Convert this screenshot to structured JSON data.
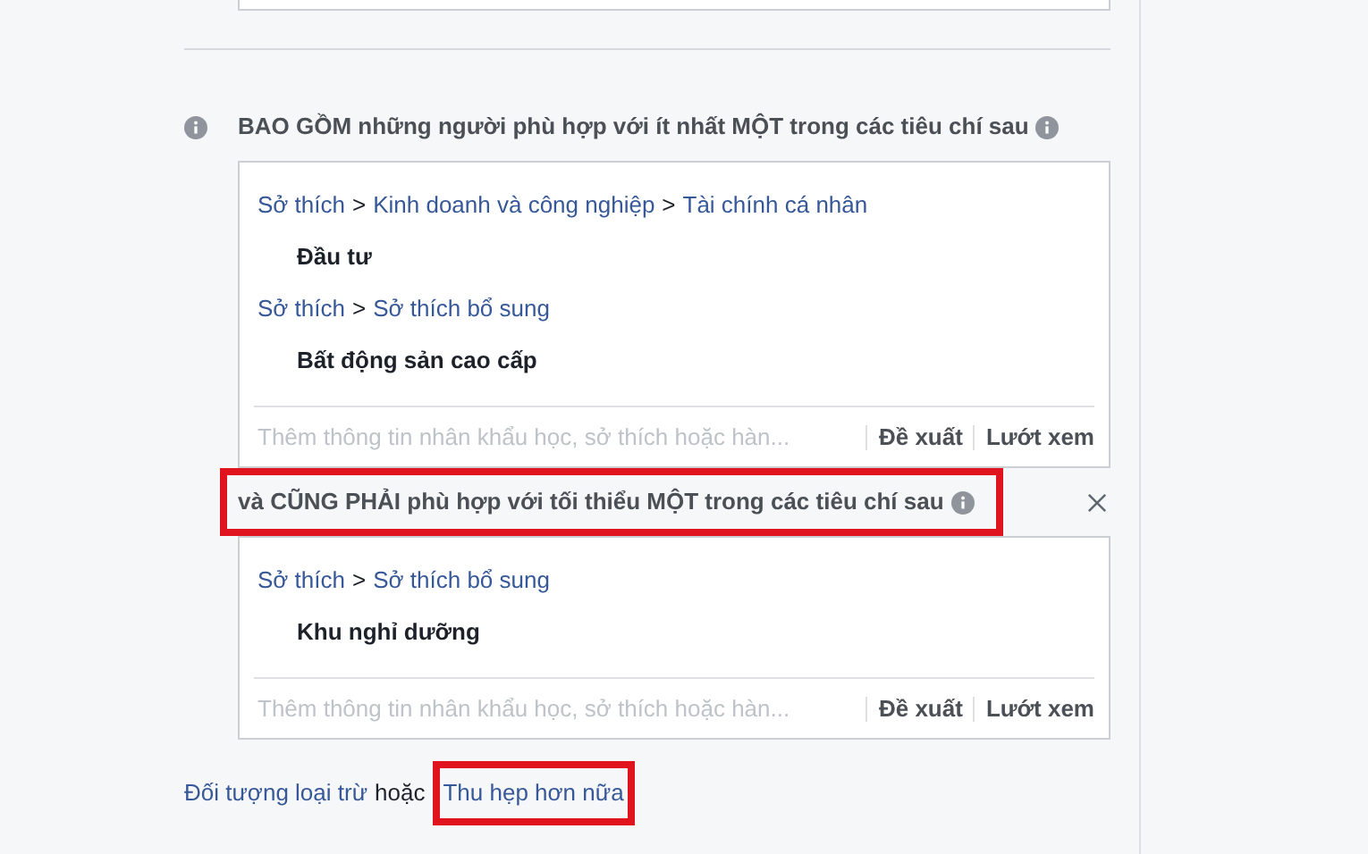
{
  "groups": [
    {
      "heading": "BAO GỒM những người phù hợp với ít nhất MỘT trong các tiêu chí sau",
      "leading_info": true,
      "highlighted": false,
      "removable": false,
      "entries": [
        {
          "path": [
            {
              "kind": "link",
              "text": "Sở thích"
            },
            {
              "kind": "separator",
              "text": ">"
            },
            {
              "kind": "link",
              "text": "Kinh doanh và công nghiệp"
            },
            {
              "kind": "separator",
              "text": ">"
            },
            {
              "kind": "link",
              "text": "Tài chính cá nhân"
            }
          ],
          "items": [
            "Đầu tư"
          ]
        },
        {
          "path": [
            {
              "kind": "link",
              "text": "Sở thích"
            },
            {
              "kind": "separator",
              "text": ">"
            },
            {
              "kind": "link",
              "text": "Sở thích bổ sung"
            }
          ],
          "items": [
            "Bất động sản cao cấp"
          ]
        }
      ],
      "search": {
        "placeholder": "Thêm thông tin nhân khẩu học, sở thích hoặc hàn...",
        "actions": [
          "Đề xuất",
          "Lướt xem"
        ]
      }
    },
    {
      "heading": "và CŨNG PHẢI phù hợp với tối thiểu MỘT trong các tiêu chí sau",
      "leading_info": false,
      "highlighted": true,
      "removable": true,
      "entries": [
        {
          "path": [
            {
              "kind": "link",
              "text": "Sở thích"
            },
            {
              "kind": "separator",
              "text": ">"
            },
            {
              "kind": "link",
              "text": "Sở thích bổ sung"
            }
          ],
          "items": [
            "Khu nghỉ dưỡng"
          ]
        }
      ],
      "search": {
        "placeholder": "Thêm thông tin nhân khẩu học, sở thích hoặc hàn...",
        "actions": [
          "Đề xuất",
          "Lướt xem"
        ]
      }
    }
  ],
  "footer": [
    {
      "kind": "link",
      "text": "Đối tượng loại trừ",
      "highlighted": false
    },
    {
      "kind": "text",
      "text": "hoặc",
      "highlighted": false
    },
    {
      "kind": "link",
      "text": "Thu hẹp hơn nữa",
      "highlighted": true
    }
  ]
}
